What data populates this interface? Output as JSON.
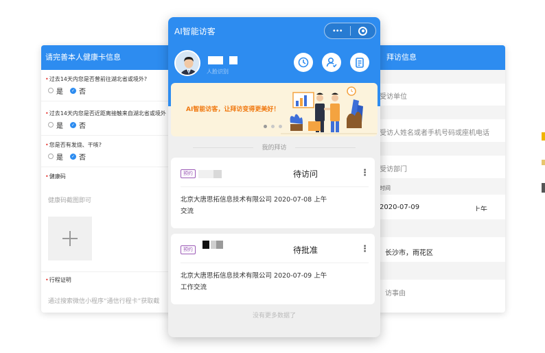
{
  "health_form": {
    "title": "请完善本人健康卡信息",
    "q1": "过去14天内您是否曾前往湖北省或境外?",
    "q2": "过去14天内您是否近距离接触来自湖北省或境外",
    "q3": "您是否有发烧、干咳?",
    "option_yes": "是",
    "option_no": "否",
    "health_code_label": "健康码",
    "health_code_hint": "健康码截图即可",
    "trip_label": "行程证明",
    "trip_hint": "通过搜索微信小程序“通信行程卡”获取截"
  },
  "visitor_form": {
    "title_partial": "拜访信息",
    "unit_placeholder": "受访单位",
    "person_placeholder": "受访人姓名或者手机号码或座机电话",
    "dept_placeholder": "受访部门",
    "time_label": "时间",
    "date_value": "2020-07-09",
    "period_value": "上午",
    "city_value": "长沙市，雨花区",
    "reason_placeholder": "访事由"
  },
  "phone": {
    "app_title": "AI智能访客",
    "capsule_dots": "•••",
    "user_subtitle": "人脸识别",
    "actions": [
      "clock-icon",
      "user-check-icon",
      "clipboard-icon"
    ],
    "banner_text": "AI智能访客，让拜访变得更美好！",
    "banner_dot_count": 3,
    "section_label": "我的拜访",
    "visits": [
      {
        "tag": "预约",
        "status": "待访问",
        "company_line": "北京大唐思拓信息技术有限公司 2020-07-08 上午",
        "reason": "交流"
      },
      {
        "tag": "预约",
        "status": "待批准",
        "company_line": "北京大唐思拓信息技术有限公司 2020-07-09 上午",
        "reason": "工作交流"
      }
    ],
    "more_icon": "⋮",
    "no_more": "没有更多数据了"
  },
  "colors": {
    "primary": "#2d8cf0",
    "banner_bg": "#fcf3dc",
    "banner_text": "#f07a12",
    "tag": "#9b59b6",
    "required": "#e53935"
  }
}
